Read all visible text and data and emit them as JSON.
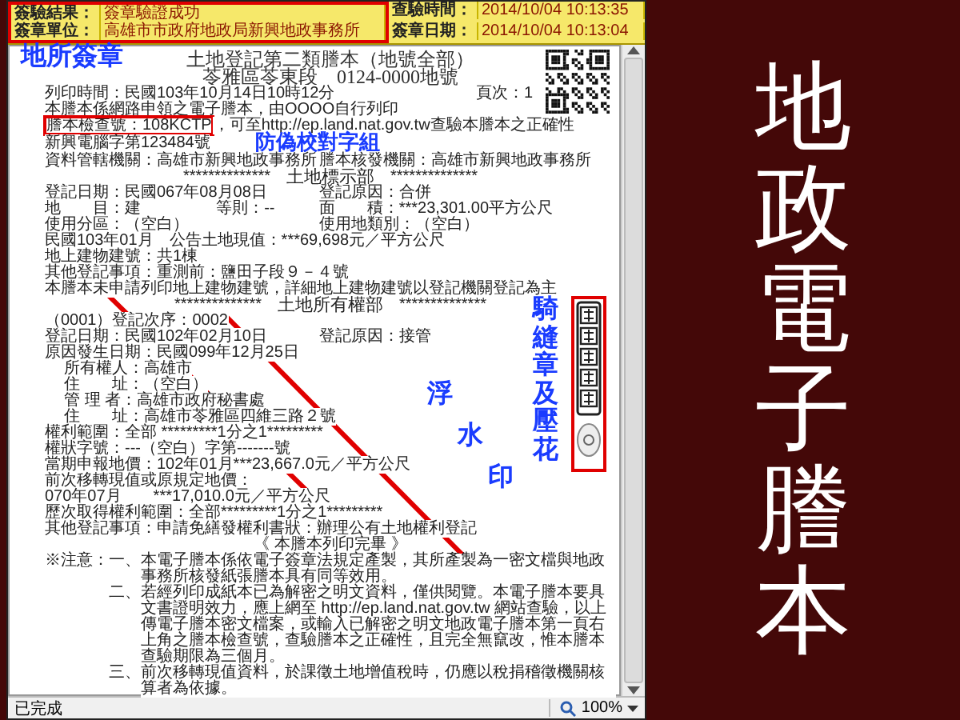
{
  "verification": [
    {
      "fields": [
        {
          "label": "簽驗結果：",
          "value": "簽章驗證成功"
        },
        {
          "label": "查驗時間：",
          "value": "2014/10/04 10:13:35"
        }
      ]
    },
    {
      "fields": [
        {
          "label": "簽章單位：",
          "value": "高雄市市政府地政局新興地政事務所"
        },
        {
          "label": "簽章日期：",
          "value": "2014/10/04 10:13:04"
        }
      ]
    }
  ],
  "document": {
    "title": "土地登記第二類謄本（地號全部）",
    "subtitle": "苓雅區苓東段　0124-0000地號",
    "rows": [
      {
        "kind": "paged",
        "cells": [
          "列印時間：民國103年10月14日10時12分",
          "頁次：1"
        ]
      },
      {
        "kind": "line",
        "cells": [
          "本謄本係網路申領之電子謄本，由OOOO自行列印"
        ]
      },
      {
        "kind": "check",
        "cells": [
          "謄本檢查號：108KCTP",
          "，可至http://ep.land.nat.gov.tw查驗本謄本之正確性"
        ]
      },
      {
        "kind": "line",
        "cells": [
          "新興電腦字第123484號"
        ],
        "callout": "防偽校對字組"
      },
      {
        "kind": "line",
        "cells": [
          "資料管轄機關：高雄市新興地政事務所",
          "謄本核發機關：高雄市新興地政事務所"
        ]
      },
      {
        "kind": "heading",
        "cells": [
          "**************",
          "土地標示部",
          "**************"
        ]
      },
      {
        "kind": "line",
        "cells": [
          "登記日期：民國067年08月08日",
          "登記原因：合併"
        ]
      },
      {
        "kind": "line",
        "cells": [
          "地　　目：建",
          "等則：--",
          "面　　積：***23,301.00平方公尺"
        ]
      },
      {
        "kind": "line",
        "cells": [
          "使用分區：（空白）",
          "使用地類別：（空白）"
        ]
      },
      {
        "kind": "line",
        "cells": [
          "民國103年01月　公告土地現值：***69,698元／平方公尺"
        ]
      },
      {
        "kind": "line",
        "cells": [
          "地上建物建號：共1棟"
        ]
      },
      {
        "kind": "line",
        "cells": [
          "其他登記事項：重測前：鹽田子段９－４號"
        ]
      },
      {
        "kind": "line",
        "cells": [
          "本謄本未申請列印地上建物建號，詳細地上建物建號以登記機關登記為主"
        ]
      },
      {
        "kind": "heading",
        "cells": [
          "**************",
          "土地所有權部",
          "**************"
        ]
      },
      {
        "kind": "line",
        "cells": [
          "（0001）登記次序：0002"
        ]
      },
      {
        "kind": "line",
        "cells": [
          "登記日期：民國102年02月10日",
          "登記原因：接管"
        ]
      },
      {
        "kind": "line",
        "cells": [
          "原因發生日期：民國099年12月25日"
        ]
      },
      {
        "kind": "indented",
        "cells": [
          "所有權人：高雄市"
        ]
      },
      {
        "kind": "indented",
        "cells": [
          "住　　址：（空白）"
        ]
      },
      {
        "kind": "indented",
        "cells": [
          "管 理 者：高雄市政府秘書處"
        ]
      },
      {
        "kind": "indented",
        "cells": [
          "住　　址：高雄市苓雅區四維三路２號"
        ]
      },
      {
        "kind": "line",
        "cells": [
          "權利範圍：全部 *********1分之1*********"
        ]
      },
      {
        "kind": "line",
        "cells": [
          "權狀字號：---（空白）字第-------號"
        ]
      },
      {
        "kind": "line",
        "cells": [
          "當期申報地價：102年01月***23,667.0元／平方公尺"
        ]
      },
      {
        "kind": "line",
        "cells": [
          "前次移轉現值或原規定地價："
        ]
      },
      {
        "kind": "line",
        "cells": [
          "070年07月　　***17,010.0元／平方公尺"
        ]
      },
      {
        "kind": "line",
        "cells": [
          "歷次取得權利範圍：全部*********1分之1*********"
        ]
      },
      {
        "kind": "line",
        "cells": [
          "其他登記事項：申請免繕發權利書狀：辦理公有土地權利登記"
        ]
      },
      {
        "kind": "center",
        "cells": [
          "《 本謄本列印完畢 》"
        ]
      }
    ],
    "notes": [
      {
        "label": "※注意：",
        "number": "一、",
        "text": "本電子謄本係依電子簽章法規定產製，其所產製為一密文檔與地政事務所核發紙張謄本具有同等效用。"
      },
      {
        "number": "二、",
        "text": "若經列印成紙本已為解密之明文資料，僅供閱覽。本電子謄本要具文書證明效力，應上網至 http://ep.land.nat.gov.tw 網站查驗，以上傳電子謄本密文檔案，或輸入已解密之明文地政電子謄本第一頁右上角之謄本檢查號，查驗謄本之正確性，且完全無竄改，惟本謄本查驗期限為三個月。"
      },
      {
        "number": "三、",
        "text": "前次移轉現值資料，於課徵土地增值稅時，仍應以稅捐稽徵機關核算者為依據。"
      }
    ]
  },
  "annotations": [
    {
      "kind": "corner",
      "text": "地所簽章"
    },
    {
      "kind": "diagonal",
      "parts": [
        "浮",
        "水",
        "印"
      ]
    },
    {
      "kind": "vertical",
      "text": "騎縫章及壓花"
    }
  ],
  "status_bar": {
    "status": "已完成",
    "zoom": "100%"
  },
  "slide_title": "地政電子謄本"
}
